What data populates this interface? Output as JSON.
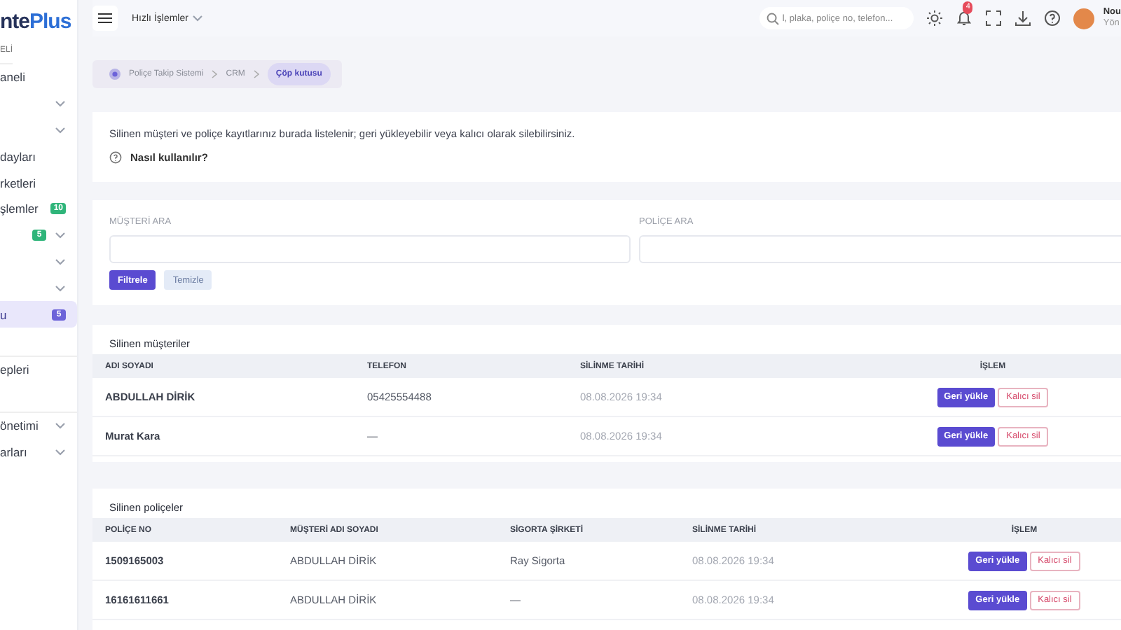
{
  "sidebar": {
    "logo": {
      "part_1": "nte",
      "part_2": "Plus"
    },
    "section_label": "ELİ",
    "items": [
      {
        "label": "aneli",
        "expandable": false,
        "selected": false
      },
      {
        "expandable": true,
        "selected": false
      },
      {
        "expandable": true,
        "selected": false
      },
      {
        "label": "dayları",
        "expandable": false,
        "selected": false
      },
      {
        "label": "rketleri",
        "expandable": false,
        "selected": false
      },
      {
        "label": "şlemler",
        "badge": {
          "text": "10",
          "color": "#2fb57a"
        },
        "expandable": false,
        "selected": false
      },
      {
        "badge": {
          "text": "5",
          "color": "#2fb57a"
        },
        "expandable": true,
        "selected": false
      },
      {
        "expandable": true,
        "selected": false
      },
      {
        "expandable": true,
        "selected": false
      },
      {
        "label": "u",
        "badge": {
          "text": "5",
          "color": "#6c63d9"
        },
        "expandable": false,
        "selected": true
      },
      {
        "label": "epleri",
        "separated": true,
        "expandable": false,
        "selected": false
      },
      {
        "label": "önetimi",
        "separated": true,
        "expandable": true,
        "selected": false
      },
      {
        "label": "arları",
        "expandable": true,
        "selected": false
      }
    ]
  },
  "topbar": {
    "quick_actions": "Hızlı İşlemler",
    "search": {
      "placeholder": "l, plaka, poliçe no, telefon..."
    },
    "notifications": "4",
    "user": {
      "name": "Nou",
      "role": "Yön"
    }
  },
  "breadcrumb": [
    {
      "label": "Poliçe Takip Sistemi",
      "selected": false
    },
    {
      "label": "CRM",
      "selected": false
    },
    {
      "label": "Çöp kutusu",
      "selected": true
    }
  ],
  "info": {
    "text": "Silinen müşteri ve poliçe kayıtlarınız burada listelenir; geri yükleyebilir veya kalıcı olarak silebilirsiniz.",
    "help_link": "Nasıl kullanılır?"
  },
  "filters": {
    "fields": [
      {
        "label": "MÜŞTERİ ARA"
      },
      {
        "label": "POLİÇE ARA"
      }
    ],
    "buttons": [
      "Filtrele",
      "Temizle"
    ]
  },
  "tables": [
    {
      "title": "Silinen müşteriler",
      "columns": [
        "ADI SOYADI",
        "TELEFON",
        "SİLİNME TARİHİ",
        "İŞLEM"
      ],
      "rows": [
        {
          "cells": [
            "ABDULLAH DİRİK",
            "05425554488",
            "08.08.2026 19:34"
          ],
          "actions": [
            "Geri yükle",
            "Kalıcı sil"
          ]
        },
        {
          "cells": [
            "Murat Kara",
            "—",
            "08.08.2026 19:34"
          ],
          "actions": [
            "Geri yükle",
            "Kalıcı sil"
          ]
        }
      ]
    },
    {
      "title": "Silinen poliçeler",
      "columns": [
        "POLİÇE NO",
        "MÜŞTERİ ADI SOYADI",
        "SİGORTA ŞİRKETİ",
        "SİLİNME TARİHİ",
        "İŞLEM"
      ],
      "rows": [
        {
          "cells": [
            "1509165003",
            "ABDULLAH DİRİK",
            "Ray Sigorta",
            "08.08.2026 19:34"
          ],
          "actions": [
            "Geri yükle",
            "Kalıcı sil"
          ]
        },
        {
          "cells": [
            "16161611661",
            "ABDULLAH DİRİK",
            "—",
            "08.08.2026 19:34"
          ],
          "actions": [
            "Geri yükle",
            "Kalıcı sil"
          ]
        }
      ]
    }
  ]
}
